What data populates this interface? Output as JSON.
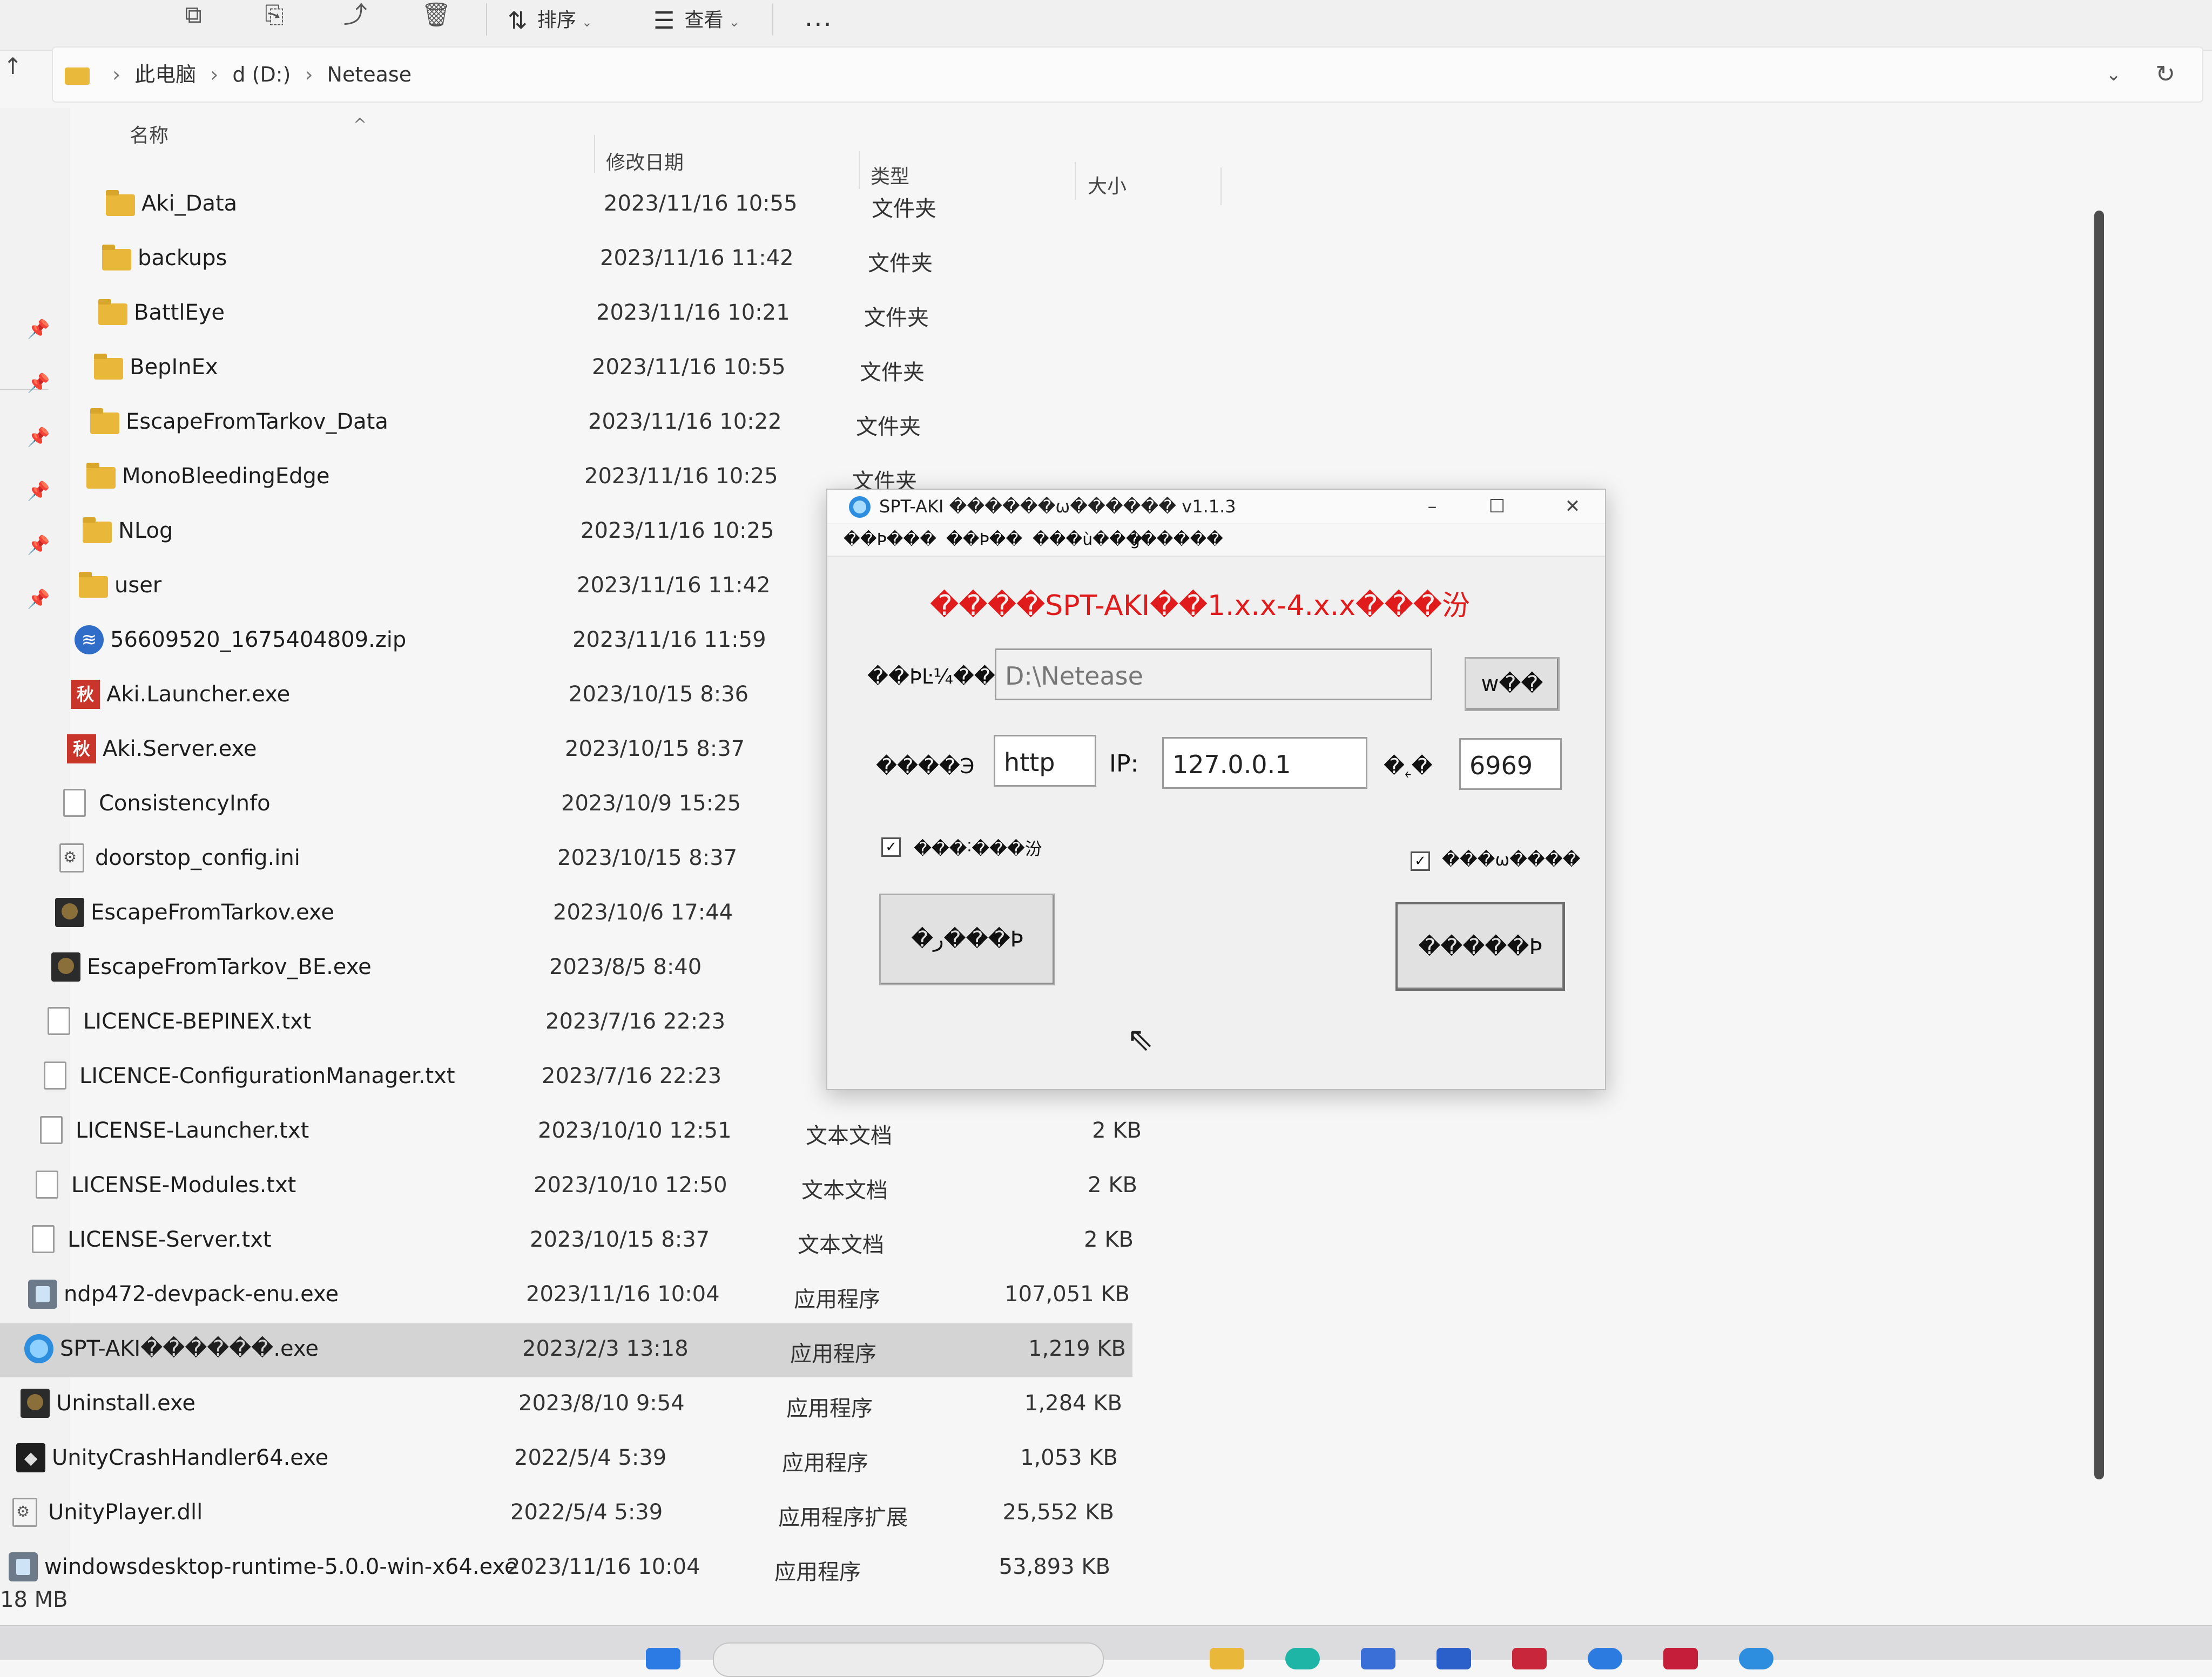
{
  "toolbar": {
    "sort_label": "排序",
    "view_label": "查看",
    "more_label": "..."
  },
  "address": {
    "crumbs": [
      "此电脑",
      "d (D:)",
      "Netease"
    ]
  },
  "columns": {
    "name": "名称",
    "date": "修改日期",
    "type": "类型",
    "size": "大小"
  },
  "files": [
    {
      "name": "Aki_Data",
      "date": "2023/11/16 10:55",
      "type": "文件夹",
      "size": "",
      "icon": "folder-icon"
    },
    {
      "name": "backups",
      "date": "2023/11/16 11:42",
      "type": "文件夹",
      "size": "",
      "icon": "folder-icon"
    },
    {
      "name": "BattlEye",
      "date": "2023/11/16 10:21",
      "type": "文件夹",
      "size": "",
      "icon": "folder-icon"
    },
    {
      "name": "BepInEx",
      "date": "2023/11/16 10:55",
      "type": "文件夹",
      "size": "",
      "icon": "folder-icon"
    },
    {
      "name": "EscapeFromTarkov_Data",
      "date": "2023/11/16 10:22",
      "type": "文件夹",
      "size": "",
      "icon": "folder-icon"
    },
    {
      "name": "MonoBleedingEdge",
      "date": "2023/11/16 10:25",
      "type": "文件夹",
      "size": "",
      "icon": "folder-icon"
    },
    {
      "name": "NLog",
      "date": "2023/11/16 10:25",
      "type": "",
      "size": "",
      "icon": "folder-icon"
    },
    {
      "name": "user",
      "date": "2023/11/16 11:42",
      "type": "",
      "size": "",
      "icon": "folder-icon"
    },
    {
      "name": "56609520_1675404809.zip",
      "date": "2023/11/16 11:59",
      "type": "",
      "size": "",
      "icon": "zip-icon"
    },
    {
      "name": "Aki.Launcher.exe",
      "date": "2023/10/15 8:36",
      "type": "",
      "size": "",
      "icon": "aki-exe-icon"
    },
    {
      "name": "Aki.Server.exe",
      "date": "2023/10/15 8:37",
      "type": "",
      "size": "",
      "icon": "aki-exe-icon"
    },
    {
      "name": "ConsistencyInfo",
      "date": "2023/10/9 15:25",
      "type": "",
      "size": "",
      "icon": "text-file-icon"
    },
    {
      "name": "doorstop_config.ini",
      "date": "2023/10/15 8:37",
      "type": "",
      "size": "",
      "icon": "config-file-icon"
    },
    {
      "name": "EscapeFromTarkov.exe",
      "date": "2023/10/6 17:44",
      "type": "",
      "size": "",
      "icon": "tarkov-exe-icon"
    },
    {
      "name": "EscapeFromTarkov_BE.exe",
      "date": "2023/8/5 8:40",
      "type": "",
      "size": "",
      "icon": "tarkov-exe-icon"
    },
    {
      "name": "LICENCE-BEPINEX.txt",
      "date": "2023/7/16 22:23",
      "type": "",
      "size": "",
      "icon": "text-file-icon"
    },
    {
      "name": "LICENCE-ConfigurationManager.txt",
      "date": "2023/7/16 22:23",
      "type": "",
      "size": "",
      "icon": "text-file-icon"
    },
    {
      "name": "LICENSE-Launcher.txt",
      "date": "2023/10/10 12:51",
      "type": "文本文档",
      "size": "2 KB",
      "icon": "text-file-icon"
    },
    {
      "name": "LICENSE-Modules.txt",
      "date": "2023/10/10 12:50",
      "type": "文本文档",
      "size": "2 KB",
      "icon": "text-file-icon"
    },
    {
      "name": "LICENSE-Server.txt",
      "date": "2023/10/15 8:37",
      "type": "文本文档",
      "size": "2 KB",
      "icon": "text-file-icon"
    },
    {
      "name": "ndp472-devpack-enu.exe",
      "date": "2023/11/16 10:04",
      "type": "应用程序",
      "size": "107,051 KB",
      "icon": "installer-icon"
    },
    {
      "name": "SPT-AKI������.exe",
      "date": "2023/2/3 13:18",
      "type": "应用程序",
      "size": "1,219 KB",
      "icon": "spt-exe-icon",
      "selected": true
    },
    {
      "name": "Uninstall.exe",
      "date": "2023/8/10 9:54",
      "type": "应用程序",
      "size": "1,284 KB",
      "icon": "tarkov-exe-icon"
    },
    {
      "name": "UnityCrashHandler64.exe",
      "date": "2022/5/4 5:39",
      "type": "应用程序",
      "size": "1,053 KB",
      "icon": "unity-icon"
    },
    {
      "name": "UnityPlayer.dll",
      "date": "2022/5/4 5:39",
      "type": "应用程序扩展",
      "size": "25,552 KB",
      "icon": "dll-file-icon"
    },
    {
      "name": "windowsdesktop-runtime-5.0.0-win-x64.exe",
      "date": "2023/11/16 10:04",
      "type": "应用程序",
      "size": "53,893 KB",
      "icon": "installer-icon"
    }
  ],
  "status": {
    "text": "18 MB"
  },
  "dialog": {
    "title": "SPT-AKI ������ω������ v1.1.3",
    "menu": [
      "��Þ���",
      "��Þ��",
      "���ù���",
      "ģ�����"
    ],
    "headline": "����SPT-AKI��1.x.x-4.x.x���汾",
    "path_label": "��ÞĿ¼��",
    "path_value": "D:\\Netease",
    "browse_label": "w��",
    "protocol_label": "����Э",
    "protocol_value": "http",
    "ip_label": "IP:",
    "ip_value": "127.0.0.1",
    "port_label": "�˿�",
    "port_value": "6969",
    "check1_label": "���˸���汾",
    "check2_label": "���ѡ����",
    "check_mark": "✓",
    "btn_left": "�ر���Þ",
    "btn_right": "�����Þ"
  },
  "colors": {
    "headline": "#e01b1b",
    "selected_row": "#d4d4d4",
    "folder": "#e9b73a"
  }
}
